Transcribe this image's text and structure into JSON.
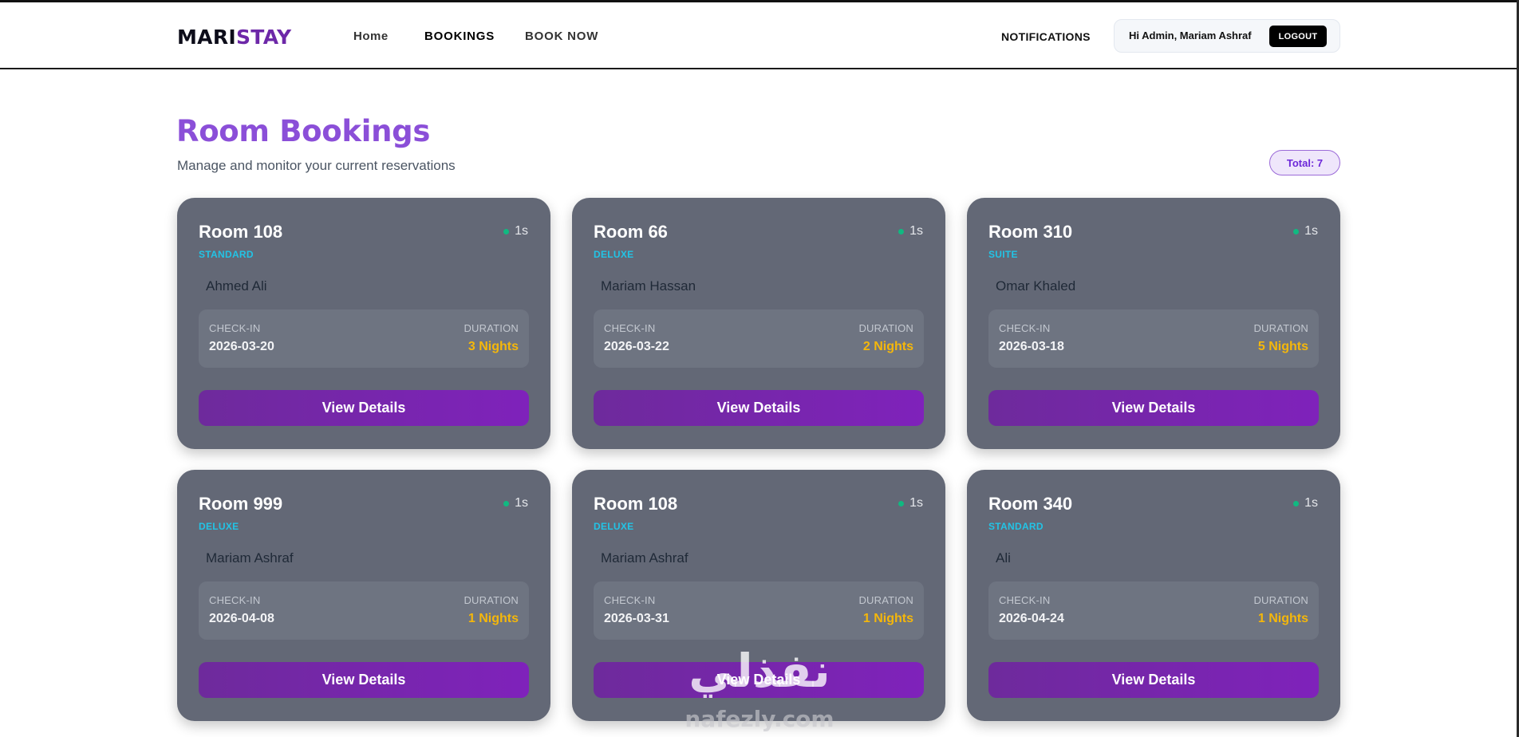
{
  "brand": {
    "part1": "MARI",
    "part2": "STAY"
  },
  "nav": {
    "home": "Home",
    "bookings": "BOOKINGS",
    "book_now": "BOOK NOW",
    "notifications": "NOTIFICATIONS"
  },
  "user": {
    "greeting": "Hi Admin, Mariam Ashraf",
    "logout": "LOGOUT"
  },
  "page": {
    "title": "Room Bookings",
    "subtitle": "Manage and monitor your current reservations",
    "total": "Total: 7"
  },
  "labels": {
    "checkin": "CHECK-IN",
    "duration": "DURATION",
    "view_details": "View Details"
  },
  "bookings": [
    {
      "room": "Room 108",
      "type": "STANDARD",
      "status": "1s",
      "guest": "Ahmed Ali",
      "checkin": "2026-03-20",
      "duration": "3 Nights"
    },
    {
      "room": "Room 66",
      "type": "DELUXE",
      "status": "1s",
      "guest": "Mariam Hassan",
      "checkin": "2026-03-22",
      "duration": "2 Nights"
    },
    {
      "room": "Room 310",
      "type": "SUITE",
      "status": "1s",
      "guest": "Omar Khaled",
      "checkin": "2026-03-18",
      "duration": "5 Nights"
    },
    {
      "room": "Room 999",
      "type": "DELUXE",
      "status": "1s",
      "guest": "Mariam Ashraf",
      "checkin": "2026-04-08",
      "duration": "1 Nights"
    },
    {
      "room": "Room 108",
      "type": "DELUXE",
      "status": "1s",
      "guest": "Mariam Ashraf",
      "checkin": "2026-03-31",
      "duration": "1 Nights"
    },
    {
      "room": "Room 340",
      "type": "STANDARD",
      "status": "1s",
      "guest": "Ali",
      "checkin": "2026-04-24",
      "duration": "1 Nights"
    }
  ],
  "watermark": {
    "arabic": "نفذلي",
    "domain": "nafezly.com"
  },
  "colors": {
    "accent": "#8b4fd8",
    "button": "#7f22bb",
    "card": "#636876",
    "room_type": "#22c4e6",
    "duration": "#f5b70a",
    "status_dot": "#10b981"
  }
}
